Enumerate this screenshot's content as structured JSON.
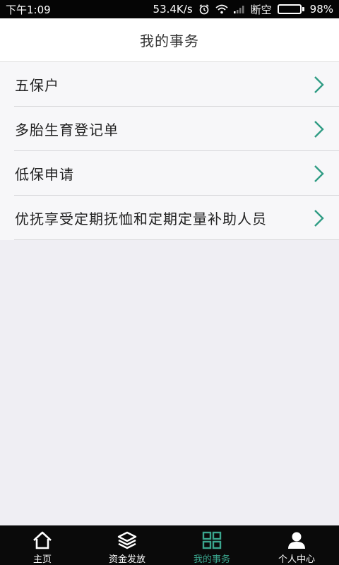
{
  "status_bar": {
    "time": "下午1:09",
    "net_speed": "53.4K/s",
    "carrier": "断空",
    "battery": "98%",
    "battery_level": 0.98,
    "icons": [
      "alarm-icon",
      "wifi-icon",
      "signal-icon",
      "battery-icon"
    ]
  },
  "header": {
    "title": "我的事务"
  },
  "menu": {
    "items": [
      {
        "label": "五保户"
      },
      {
        "label": "多胎生育登记单"
      },
      {
        "label": "低保申请"
      },
      {
        "label": "优抚享受定期抚恤和定期定量补助人员"
      }
    ],
    "chevron_color": "#2f9c84"
  },
  "tabs": [
    {
      "label": "主页",
      "icon": "home-icon",
      "active": false
    },
    {
      "label": "资金发放",
      "icon": "layers-icon",
      "active": false
    },
    {
      "label": "我的事务",
      "icon": "grid-icon",
      "active": true
    },
    {
      "label": "个人中心",
      "icon": "person-icon",
      "active": false
    }
  ],
  "colors": {
    "accent": "#3aa58d",
    "tab_bar_bg": "#0a0a0a",
    "status_bar_bg": "#050505",
    "page_bg": "#efeef3"
  }
}
